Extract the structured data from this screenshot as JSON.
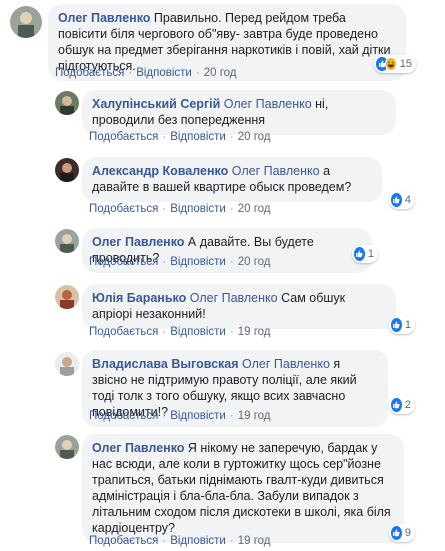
{
  "actions": {
    "like": "Подобається",
    "reply": "Відповісти"
  },
  "comments": [
    {
      "author": "Олег Павленко",
      "mention": "",
      "text": "Правильно. Перед рейдом треба повісити біля чергового об\"яву- завтра буде проведено обшук на предмет зберігання наркотиків і повій, хай дітки підготуються.",
      "time": "20 год",
      "reactions": "15",
      "reaction_icons": [
        "like-icon",
        "haha-icon"
      ]
    },
    {
      "author": "Халупінський Сергій",
      "mention": "Олег Павленко",
      "text": "ні, проводили без попередження",
      "time": "20 год",
      "reactions": "",
      "reaction_icons": []
    },
    {
      "author": "Александр Коваленко",
      "mention": "Олег Павленко",
      "text": "а давайте в вашей квартире обыск проведем?",
      "time": "20 год",
      "reactions": "4",
      "reaction_icons": [
        "like-icon"
      ]
    },
    {
      "author": "Олег Павленко",
      "mention": "",
      "text": "А давайте. Вы будете проводить?",
      "time": "20 год",
      "reactions": "1",
      "reaction_icons": [
        "like-icon"
      ]
    },
    {
      "author": "Юлія Баранько",
      "mention": "Олег Павленко",
      "text": "Сам обшук апріорі незаконний!",
      "time": "19 год",
      "reactions": "1",
      "reaction_icons": [
        "like-icon"
      ]
    },
    {
      "author": "Владислава Выговская",
      "mention": "Олег Павленко",
      "text": "я звісно не підтримую правоту поліції, але який тоді толк з того обшуку, якщо всих завчасно повідомити!?",
      "time": "19 год",
      "reactions": "2",
      "reaction_icons": [
        "like-icon"
      ]
    },
    {
      "author": "Олег Павленко",
      "mention": "",
      "text": "Я нікому не заперечую, бардак у нас всюди, але коли в гуртожитку щось сер\"йозне трапиться, батьки піднімають гвалт-куди дивиться адміністрація і бла-бла-бла. Забули випадок з літальним сходом після дискотеки в школі, яка біля кардіоцентру?",
      "time": "19 год",
      "reactions": "9",
      "reaction_icons": [
        "like-icon"
      ]
    }
  ],
  "colors": {
    "link": "#385898",
    "bubble": "#f2f3f5",
    "like": "#1877f2"
  }
}
